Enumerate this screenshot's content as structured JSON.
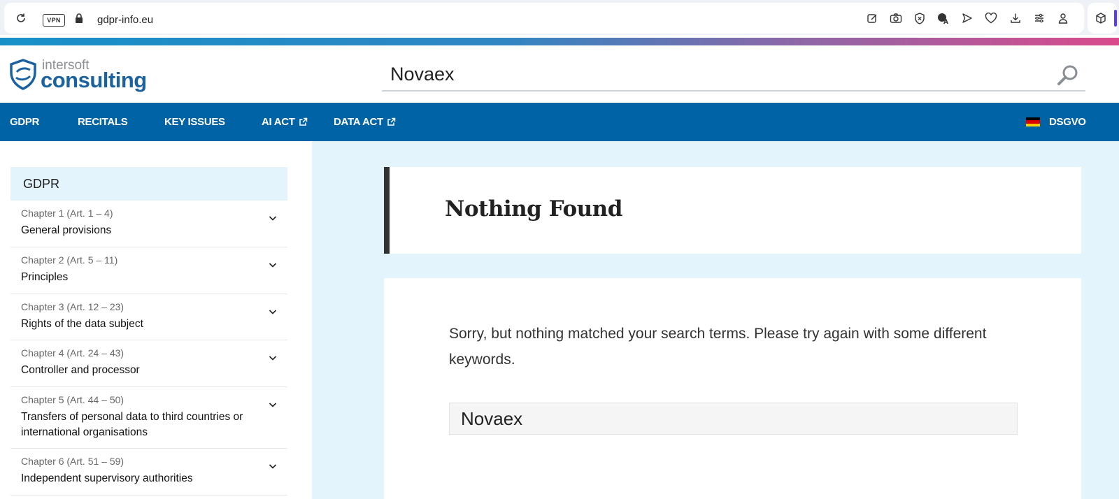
{
  "browser": {
    "vpn_label": "VPN",
    "url": "gdpr-info.eu"
  },
  "header": {
    "logo_top": "intersoft",
    "logo_bottom": "consulting",
    "search_value": "Novaex"
  },
  "nav": {
    "items": [
      {
        "label": "GDPR"
      },
      {
        "label": "RECITALS"
      },
      {
        "label": "KEY ISSUES"
      },
      {
        "label": "AI ACT"
      },
      {
        "label": "DATA ACT"
      }
    ],
    "lang_label": "DSGVO"
  },
  "sidebar": {
    "title": "GDPR",
    "chapters": [
      {
        "sub": "Chapter 1 (Art. 1 – 4)",
        "title": "General provisions"
      },
      {
        "sub": "Chapter 2 (Art. 5 – 11)",
        "title": "Principles"
      },
      {
        "sub": "Chapter 3 (Art. 12 – 23)",
        "title": "Rights of the data subject"
      },
      {
        "sub": "Chapter 4 (Art. 24 – 43)",
        "title": "Controller and processor"
      },
      {
        "sub": "Chapter 5 (Art. 44 – 50)",
        "title": "Transfers of personal data to third countries or international organisations"
      },
      {
        "sub": "Chapter 6 (Art. 51 – 59)",
        "title": "Independent supervisory authorities"
      }
    ]
  },
  "main": {
    "heading": "Nothing Found",
    "message": "Sorry, but nothing matched your search terms. Please try again with some different keywords.",
    "search_value": "Novaex"
  },
  "colors": {
    "nav_bg": "#0063a5",
    "brand": "#1a62a0",
    "main_bg": "#e4f4fc"
  }
}
